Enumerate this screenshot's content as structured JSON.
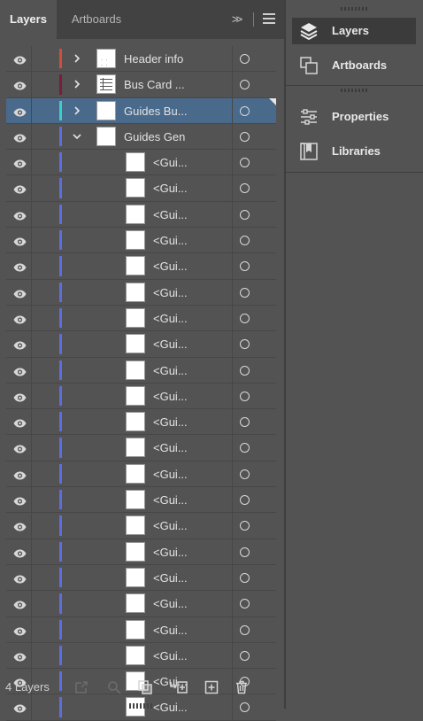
{
  "tabs": {
    "layers": "Layers",
    "artboards": "Artboards"
  },
  "panel_menu": {
    "expand_glyph": ">>"
  },
  "colors": {
    "row_selected": "#4a6a8c",
    "layer_header": "#d64b3c",
    "layer_bus": "#7a1c3f",
    "layer_guides_bu": "#3ad0c8",
    "layer_guides_gen": "#5b6ee0"
  },
  "layers": [
    {
      "name": "Header info",
      "expanded": false,
      "level": 1,
      "color": "#d64b3c",
      "thumb": "dots",
      "selected": false
    },
    {
      "name": "Bus Card ...",
      "expanded": false,
      "level": 1,
      "color": "#7a1c3f",
      "thumb": "grid",
      "selected": false
    },
    {
      "name": "Guides Bu...",
      "expanded": false,
      "level": 1,
      "color": "#3ad0c8",
      "thumb": "blank",
      "selected": true
    },
    {
      "name": "Guides Gen",
      "expanded": true,
      "level": 1,
      "color": "#5b6ee0",
      "thumb": "blank",
      "selected": false
    },
    {
      "name": "<Gui...",
      "level": 2,
      "color": "#5b6ee0"
    },
    {
      "name": "<Gui...",
      "level": 2,
      "color": "#5b6ee0"
    },
    {
      "name": "<Gui...",
      "level": 2,
      "color": "#5b6ee0"
    },
    {
      "name": "<Gui...",
      "level": 2,
      "color": "#5b6ee0"
    },
    {
      "name": "<Gui...",
      "level": 2,
      "color": "#5b6ee0"
    },
    {
      "name": "<Gui...",
      "level": 2,
      "color": "#5b6ee0"
    },
    {
      "name": "<Gui...",
      "level": 2,
      "color": "#5b6ee0"
    },
    {
      "name": "<Gui...",
      "level": 2,
      "color": "#5b6ee0"
    },
    {
      "name": "<Gui...",
      "level": 2,
      "color": "#5b6ee0"
    },
    {
      "name": "<Gui...",
      "level": 2,
      "color": "#5b6ee0"
    },
    {
      "name": "<Gui...",
      "level": 2,
      "color": "#5b6ee0"
    },
    {
      "name": "<Gui...",
      "level": 2,
      "color": "#5b6ee0"
    },
    {
      "name": "<Gui...",
      "level": 2,
      "color": "#5b6ee0"
    },
    {
      "name": "<Gui...",
      "level": 2,
      "color": "#5b6ee0"
    },
    {
      "name": "<Gui...",
      "level": 2,
      "color": "#5b6ee0"
    },
    {
      "name": "<Gui...",
      "level": 2,
      "color": "#5b6ee0"
    },
    {
      "name": "<Gui...",
      "level": 2,
      "color": "#5b6ee0"
    },
    {
      "name": "<Gui...",
      "level": 2,
      "color": "#5b6ee0"
    },
    {
      "name": "<Gui...",
      "level": 2,
      "color": "#5b6ee0"
    },
    {
      "name": "<Gui...",
      "level": 2,
      "color": "#5b6ee0"
    },
    {
      "name": "<Gui...",
      "level": 2,
      "color": "#5b6ee0"
    },
    {
      "name": "<Gui...",
      "level": 2,
      "color": "#5b6ee0"
    }
  ],
  "footer": {
    "layer_count": "4 Layers",
    "icons": [
      "export-icon",
      "locate-object-icon",
      "make-clipping-mask-icon",
      "create-sublayer-icon",
      "create-layer-icon",
      "trash-icon"
    ]
  },
  "dock": {
    "items": [
      {
        "label": "Layers",
        "icon": "layers-icon",
        "active": true
      },
      {
        "label": "Artboards",
        "icon": "artboards-icon",
        "active": false
      },
      {
        "label": "Properties",
        "icon": "properties-icon",
        "active": false
      },
      {
        "label": "Libraries",
        "icon": "libraries-icon",
        "active": false
      }
    ]
  }
}
